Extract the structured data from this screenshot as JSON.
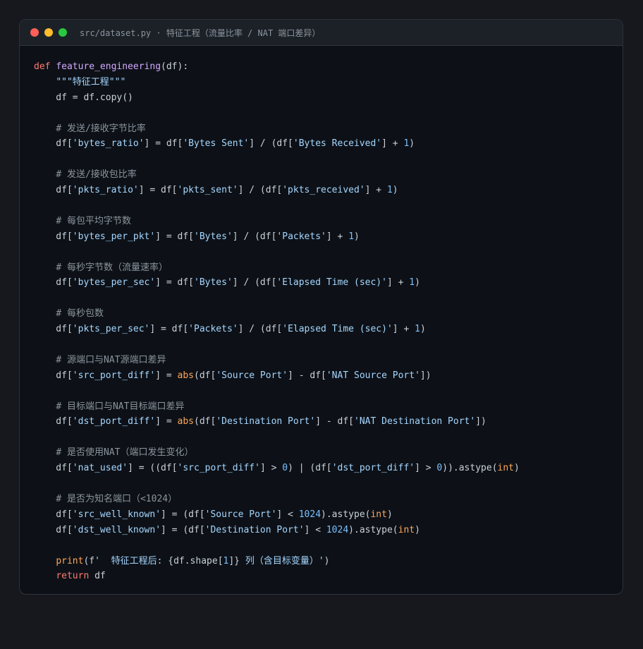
{
  "window": {
    "title": "src/dataset.py · 特征工程（流量比率 / NAT 端口差异）"
  },
  "code_lines": [
    [
      [
        "kw",
        "def "
      ],
      [
        "fn",
        "feature_engineering"
      ],
      [
        "op",
        "(df):"
      ]
    ],
    [
      [
        "op",
        "    "
      ],
      [
        "st",
        "\"\"\"特征工程\"\"\""
      ]
    ],
    [
      [
        "op",
        "    df = df.copy()"
      ]
    ],
    [],
    [
      [
        "op",
        "    "
      ],
      [
        "cm",
        "# 发送/接收字节比率"
      ]
    ],
    [
      [
        "op",
        "    df["
      ],
      [
        "st",
        "'bytes_ratio'"
      ],
      [
        "op",
        "] = df["
      ],
      [
        "st",
        "'Bytes Sent'"
      ],
      [
        "op",
        "] / (df["
      ],
      [
        "st",
        "'Bytes Received'"
      ],
      [
        "op",
        "] + "
      ],
      [
        "nu",
        "1"
      ],
      [
        "op",
        ")"
      ]
    ],
    [],
    [
      [
        "op",
        "    "
      ],
      [
        "cm",
        "# 发送/接收包比率"
      ]
    ],
    [
      [
        "op",
        "    df["
      ],
      [
        "st",
        "'pkts_ratio'"
      ],
      [
        "op",
        "] = df["
      ],
      [
        "st",
        "'pkts_sent'"
      ],
      [
        "op",
        "] / (df["
      ],
      [
        "st",
        "'pkts_received'"
      ],
      [
        "op",
        "] + "
      ],
      [
        "nu",
        "1"
      ],
      [
        "op",
        ")"
      ]
    ],
    [],
    [
      [
        "op",
        "    "
      ],
      [
        "cm",
        "# 每包平均字节数"
      ]
    ],
    [
      [
        "op",
        "    df["
      ],
      [
        "st",
        "'bytes_per_pkt'"
      ],
      [
        "op",
        "] = df["
      ],
      [
        "st",
        "'Bytes'"
      ],
      [
        "op",
        "] / (df["
      ],
      [
        "st",
        "'Packets'"
      ],
      [
        "op",
        "] + "
      ],
      [
        "nu",
        "1"
      ],
      [
        "op",
        ")"
      ]
    ],
    [],
    [
      [
        "op",
        "    "
      ],
      [
        "cm",
        "# 每秒字节数（流量速率）"
      ]
    ],
    [
      [
        "op",
        "    df["
      ],
      [
        "st",
        "'bytes_per_sec'"
      ],
      [
        "op",
        "] = df["
      ],
      [
        "st",
        "'Bytes'"
      ],
      [
        "op",
        "] / (df["
      ],
      [
        "st",
        "'Elapsed Time (sec)'"
      ],
      [
        "op",
        "] + "
      ],
      [
        "nu",
        "1"
      ],
      [
        "op",
        ")"
      ]
    ],
    [],
    [
      [
        "op",
        "    "
      ],
      [
        "cm",
        "# 每秒包数"
      ]
    ],
    [
      [
        "op",
        "    df["
      ],
      [
        "st",
        "'pkts_per_sec'"
      ],
      [
        "op",
        "] = df["
      ],
      [
        "st",
        "'Packets'"
      ],
      [
        "op",
        "] / (df["
      ],
      [
        "st",
        "'Elapsed Time (sec)'"
      ],
      [
        "op",
        "] + "
      ],
      [
        "nu",
        "1"
      ],
      [
        "op",
        ")"
      ]
    ],
    [],
    [
      [
        "op",
        "    "
      ],
      [
        "cm",
        "# 源端口与NAT源端口差异"
      ]
    ],
    [
      [
        "op",
        "    df["
      ],
      [
        "st",
        "'src_port_diff'"
      ],
      [
        "op",
        "] = "
      ],
      [
        "bi",
        "abs"
      ],
      [
        "op",
        "(df["
      ],
      [
        "st",
        "'Source Port'"
      ],
      [
        "op",
        "] - df["
      ],
      [
        "st",
        "'NAT Source Port'"
      ],
      [
        "op",
        "])"
      ]
    ],
    [],
    [
      [
        "op",
        "    "
      ],
      [
        "cm",
        "# 目标端口与NAT目标端口差异"
      ]
    ],
    [
      [
        "op",
        "    df["
      ],
      [
        "st",
        "'dst_port_diff'"
      ],
      [
        "op",
        "] = "
      ],
      [
        "bi",
        "abs"
      ],
      [
        "op",
        "(df["
      ],
      [
        "st",
        "'Destination Port'"
      ],
      [
        "op",
        "] - df["
      ],
      [
        "st",
        "'NAT Destination Port'"
      ],
      [
        "op",
        "])"
      ]
    ],
    [],
    [
      [
        "op",
        "    "
      ],
      [
        "cm",
        "# 是否使用NAT（端口发生变化）"
      ]
    ],
    [
      [
        "op",
        "    df["
      ],
      [
        "st",
        "'nat_used'"
      ],
      [
        "op",
        "] = ((df["
      ],
      [
        "st",
        "'src_port_diff'"
      ],
      [
        "op",
        "] > "
      ],
      [
        "nu",
        "0"
      ],
      [
        "op",
        ") | (df["
      ],
      [
        "st",
        "'dst_port_diff'"
      ],
      [
        "op",
        "] > "
      ],
      [
        "nu",
        "0"
      ],
      [
        "op",
        ")).astype("
      ],
      [
        "bi",
        "int"
      ],
      [
        "op",
        ")"
      ]
    ],
    [],
    [
      [
        "op",
        "    "
      ],
      [
        "cm",
        "# 是否为知名端口（<1024）"
      ]
    ],
    [
      [
        "op",
        "    df["
      ],
      [
        "st",
        "'src_well_known'"
      ],
      [
        "op",
        "] = (df["
      ],
      [
        "st",
        "'Source Port'"
      ],
      [
        "op",
        "] < "
      ],
      [
        "nu",
        "1024"
      ],
      [
        "op",
        ").astype("
      ],
      [
        "bi",
        "int"
      ],
      [
        "op",
        ")"
      ]
    ],
    [
      [
        "op",
        "    df["
      ],
      [
        "st",
        "'dst_well_known'"
      ],
      [
        "op",
        "] = (df["
      ],
      [
        "st",
        "'Destination Port'"
      ],
      [
        "op",
        "] < "
      ],
      [
        "nu",
        "1024"
      ],
      [
        "op",
        ").astype("
      ],
      [
        "bi",
        "int"
      ],
      [
        "op",
        ")"
      ]
    ],
    [],
    [
      [
        "op",
        "    "
      ],
      [
        "bi",
        "print"
      ],
      [
        "op",
        "(f"
      ],
      [
        "st",
        "'  特征工程后: "
      ],
      [
        "op",
        "{df.shape["
      ],
      [
        "nu",
        "1"
      ],
      [
        "op",
        "]}"
      ],
      [
        "st",
        " 列（含目标变量）'"
      ],
      [
        "op",
        ")"
      ]
    ],
    [
      [
        "op",
        "    "
      ],
      [
        "kw",
        "return"
      ],
      [
        "op",
        " df"
      ]
    ]
  ]
}
